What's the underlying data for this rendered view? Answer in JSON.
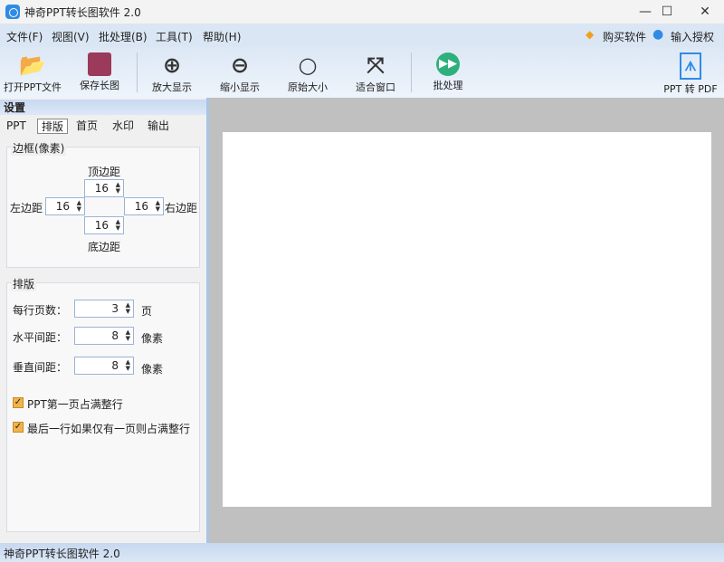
{
  "window": {
    "title": "神奇PPT转长图软件 2.0",
    "minimize": "—",
    "maximize": "☐",
    "close": "✕"
  },
  "menu": [
    "文件(F)",
    "视图(V)",
    "批处理(B)",
    "工具(T)",
    "帮助(H)"
  ],
  "menu_right": {
    "buy": "购买软件",
    "license": "输入授权码"
  },
  "toolbar": {
    "open": "打开PPT文件",
    "save": "保存长图",
    "zoom_in": "放大显示",
    "zoom_out": "缩小显示",
    "original": "原始大小",
    "fit": "适合窗口",
    "batch": "批处理",
    "pdf": "PPT 转 PDF"
  },
  "panel": {
    "title": "设置",
    "tabs": [
      "PPT",
      "排版",
      "首页",
      "水印",
      "输出"
    ],
    "active_tab": "排版"
  },
  "border": {
    "title": "边框(像素)",
    "top_label": "顶边距",
    "top": "16",
    "left_label": "左边距",
    "left": "16",
    "right_label": "右边距",
    "right": "16",
    "bottom_label": "底边距",
    "bottom": "16"
  },
  "layout": {
    "title": "排版",
    "per_row_label": "每行页数：",
    "per_row": "3",
    "per_row_unit": "页",
    "h_gap_label": "水平间距：",
    "h_gap": "8",
    "h_gap_unit": "像素",
    "v_gap_label": "垂直间距：",
    "v_gap": "8",
    "v_gap_unit": "像素",
    "cb1": "PPT第一页占满整行",
    "cb1_checked": true,
    "cb2": "最后一行如果仅有一页则占满整行",
    "cb2_checked": true
  },
  "status": "神奇PPT转长图软件 2.0",
  "colors": {
    "accent": "#2f8be6",
    "menubar": "#dbe6f4",
    "canvas": "#c0c0c0",
    "checkbox": "#f2b24c"
  }
}
